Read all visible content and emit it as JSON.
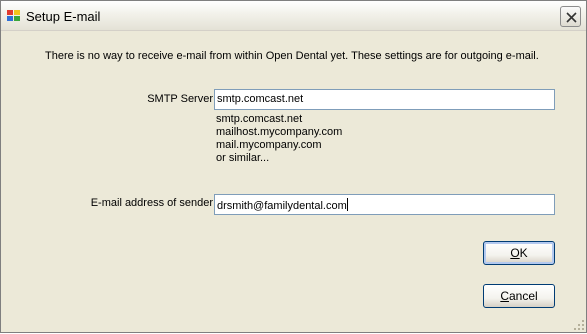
{
  "window": {
    "title": "Setup E-mail",
    "icons": {
      "app": "application-icon",
      "close": "close-icon",
      "grip": "resize-grip-icon"
    }
  },
  "info_text": "There is no way to receive e-mail from within Open Dental yet.  These settings are for outgoing e-mail.",
  "smtp": {
    "label": "SMTP Server",
    "value": "smtp.comcast.net",
    "examples": [
      "smtp.comcast.net",
      "mailhost.mycompany.com",
      "mail.mycompany.com",
      "or similar..."
    ]
  },
  "sender": {
    "label": "E-mail address of sender",
    "value": "drsmith@familydental.com"
  },
  "buttons": {
    "ok": {
      "mnemonic": "O",
      "rest": "K"
    },
    "cancel": {
      "mnemonic": "C",
      "rest": "ancel"
    }
  },
  "colors": {
    "dialog_bg": "#ece9d8",
    "input_border": "#7f9db9",
    "button_border": "#003c74",
    "default_focus": "#b3c9ef"
  }
}
